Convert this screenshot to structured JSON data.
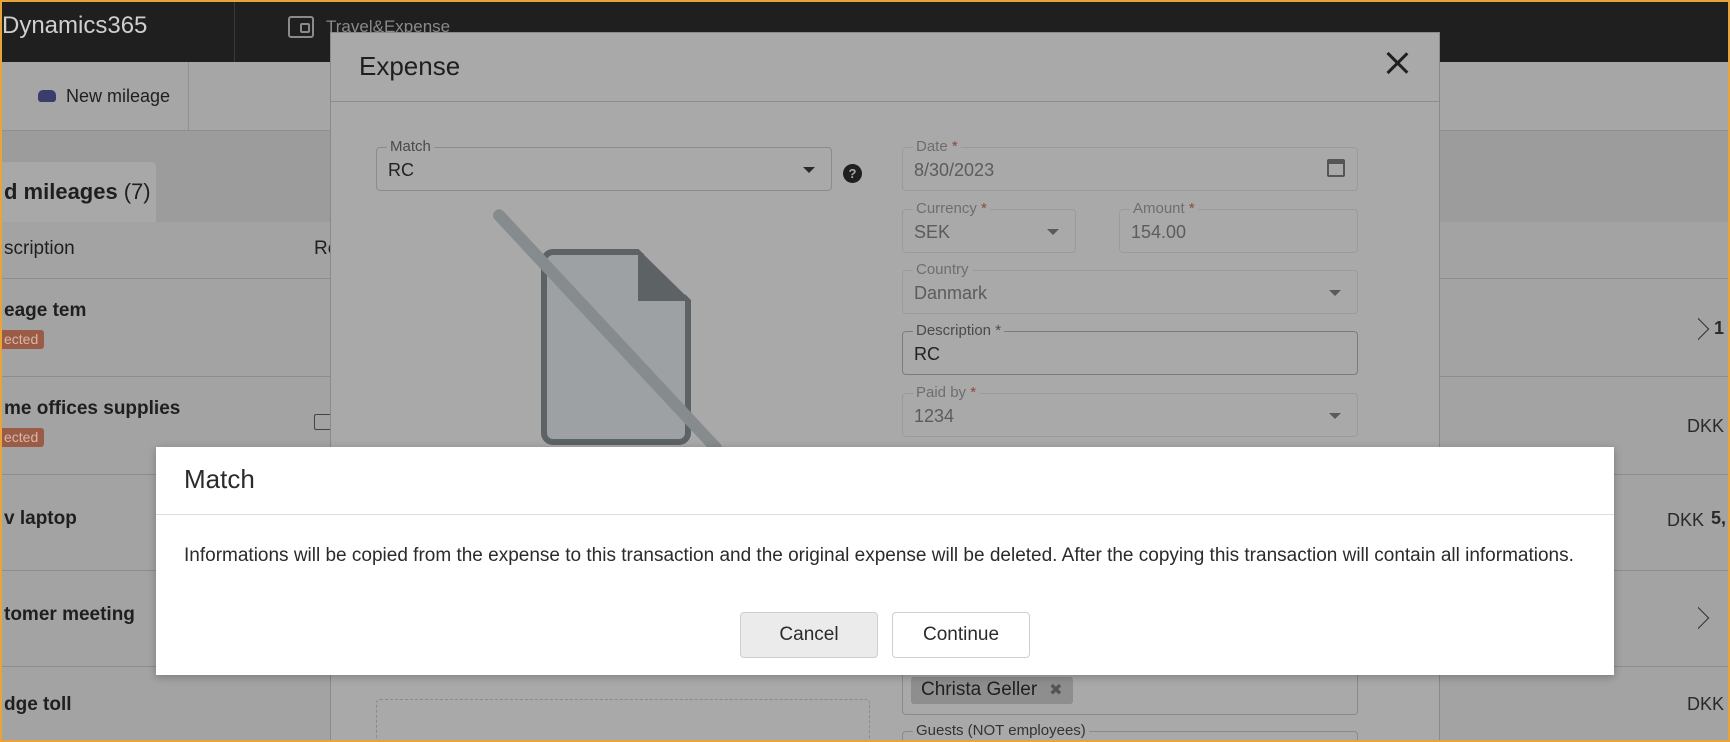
{
  "app": {
    "brand": "Dynamics365",
    "module": "Travel&Expense"
  },
  "toolbar": {
    "new_mileage": "New mileage"
  },
  "tab": {
    "label": "d mileages",
    "count": "(7)"
  },
  "list": {
    "col_description": "scription",
    "col_second": "Re",
    "rows": [
      {
        "title": "eage tem",
        "badge": "ected",
        "amount_cur": "",
        "amount": "1"
      },
      {
        "title": "me offices supplies",
        "badge": "ected",
        "amount_cur": "DKK",
        "amount": ""
      },
      {
        "title": "v laptop",
        "badge": "",
        "amount_cur": "DKK",
        "amount": "5,"
      },
      {
        "title": "tomer meeting",
        "badge": "",
        "amount_cur": "",
        "amount": ""
      },
      {
        "title": "dge toll",
        "badge": "",
        "amount_cur": "DKK",
        "amount": ""
      }
    ]
  },
  "expense": {
    "title": "Expense",
    "match": {
      "label": "Match",
      "value": "RC"
    },
    "date": {
      "label": "Date",
      "value": "8/30/2023"
    },
    "currency": {
      "label": "Currency",
      "value": "SEK"
    },
    "amount": {
      "label": "Amount",
      "value": "154.00"
    },
    "country": {
      "label": "Country",
      "value": "Danmark"
    },
    "description": {
      "label": "Description",
      "value": "RC"
    },
    "paid_by": {
      "label": "Paid by",
      "value": "1234"
    },
    "attendee_chip": "Christa Geller",
    "guests": {
      "label": "Guests (NOT employees)"
    },
    "required_mark": "*"
  },
  "match_dialog": {
    "title": "Match",
    "message": "Informations will be copied from the expense to this transaction and the original expense will be deleted. After the copying this transaction will contain all informations.",
    "cancel_label": "Cancel",
    "continue_label": "Continue"
  }
}
